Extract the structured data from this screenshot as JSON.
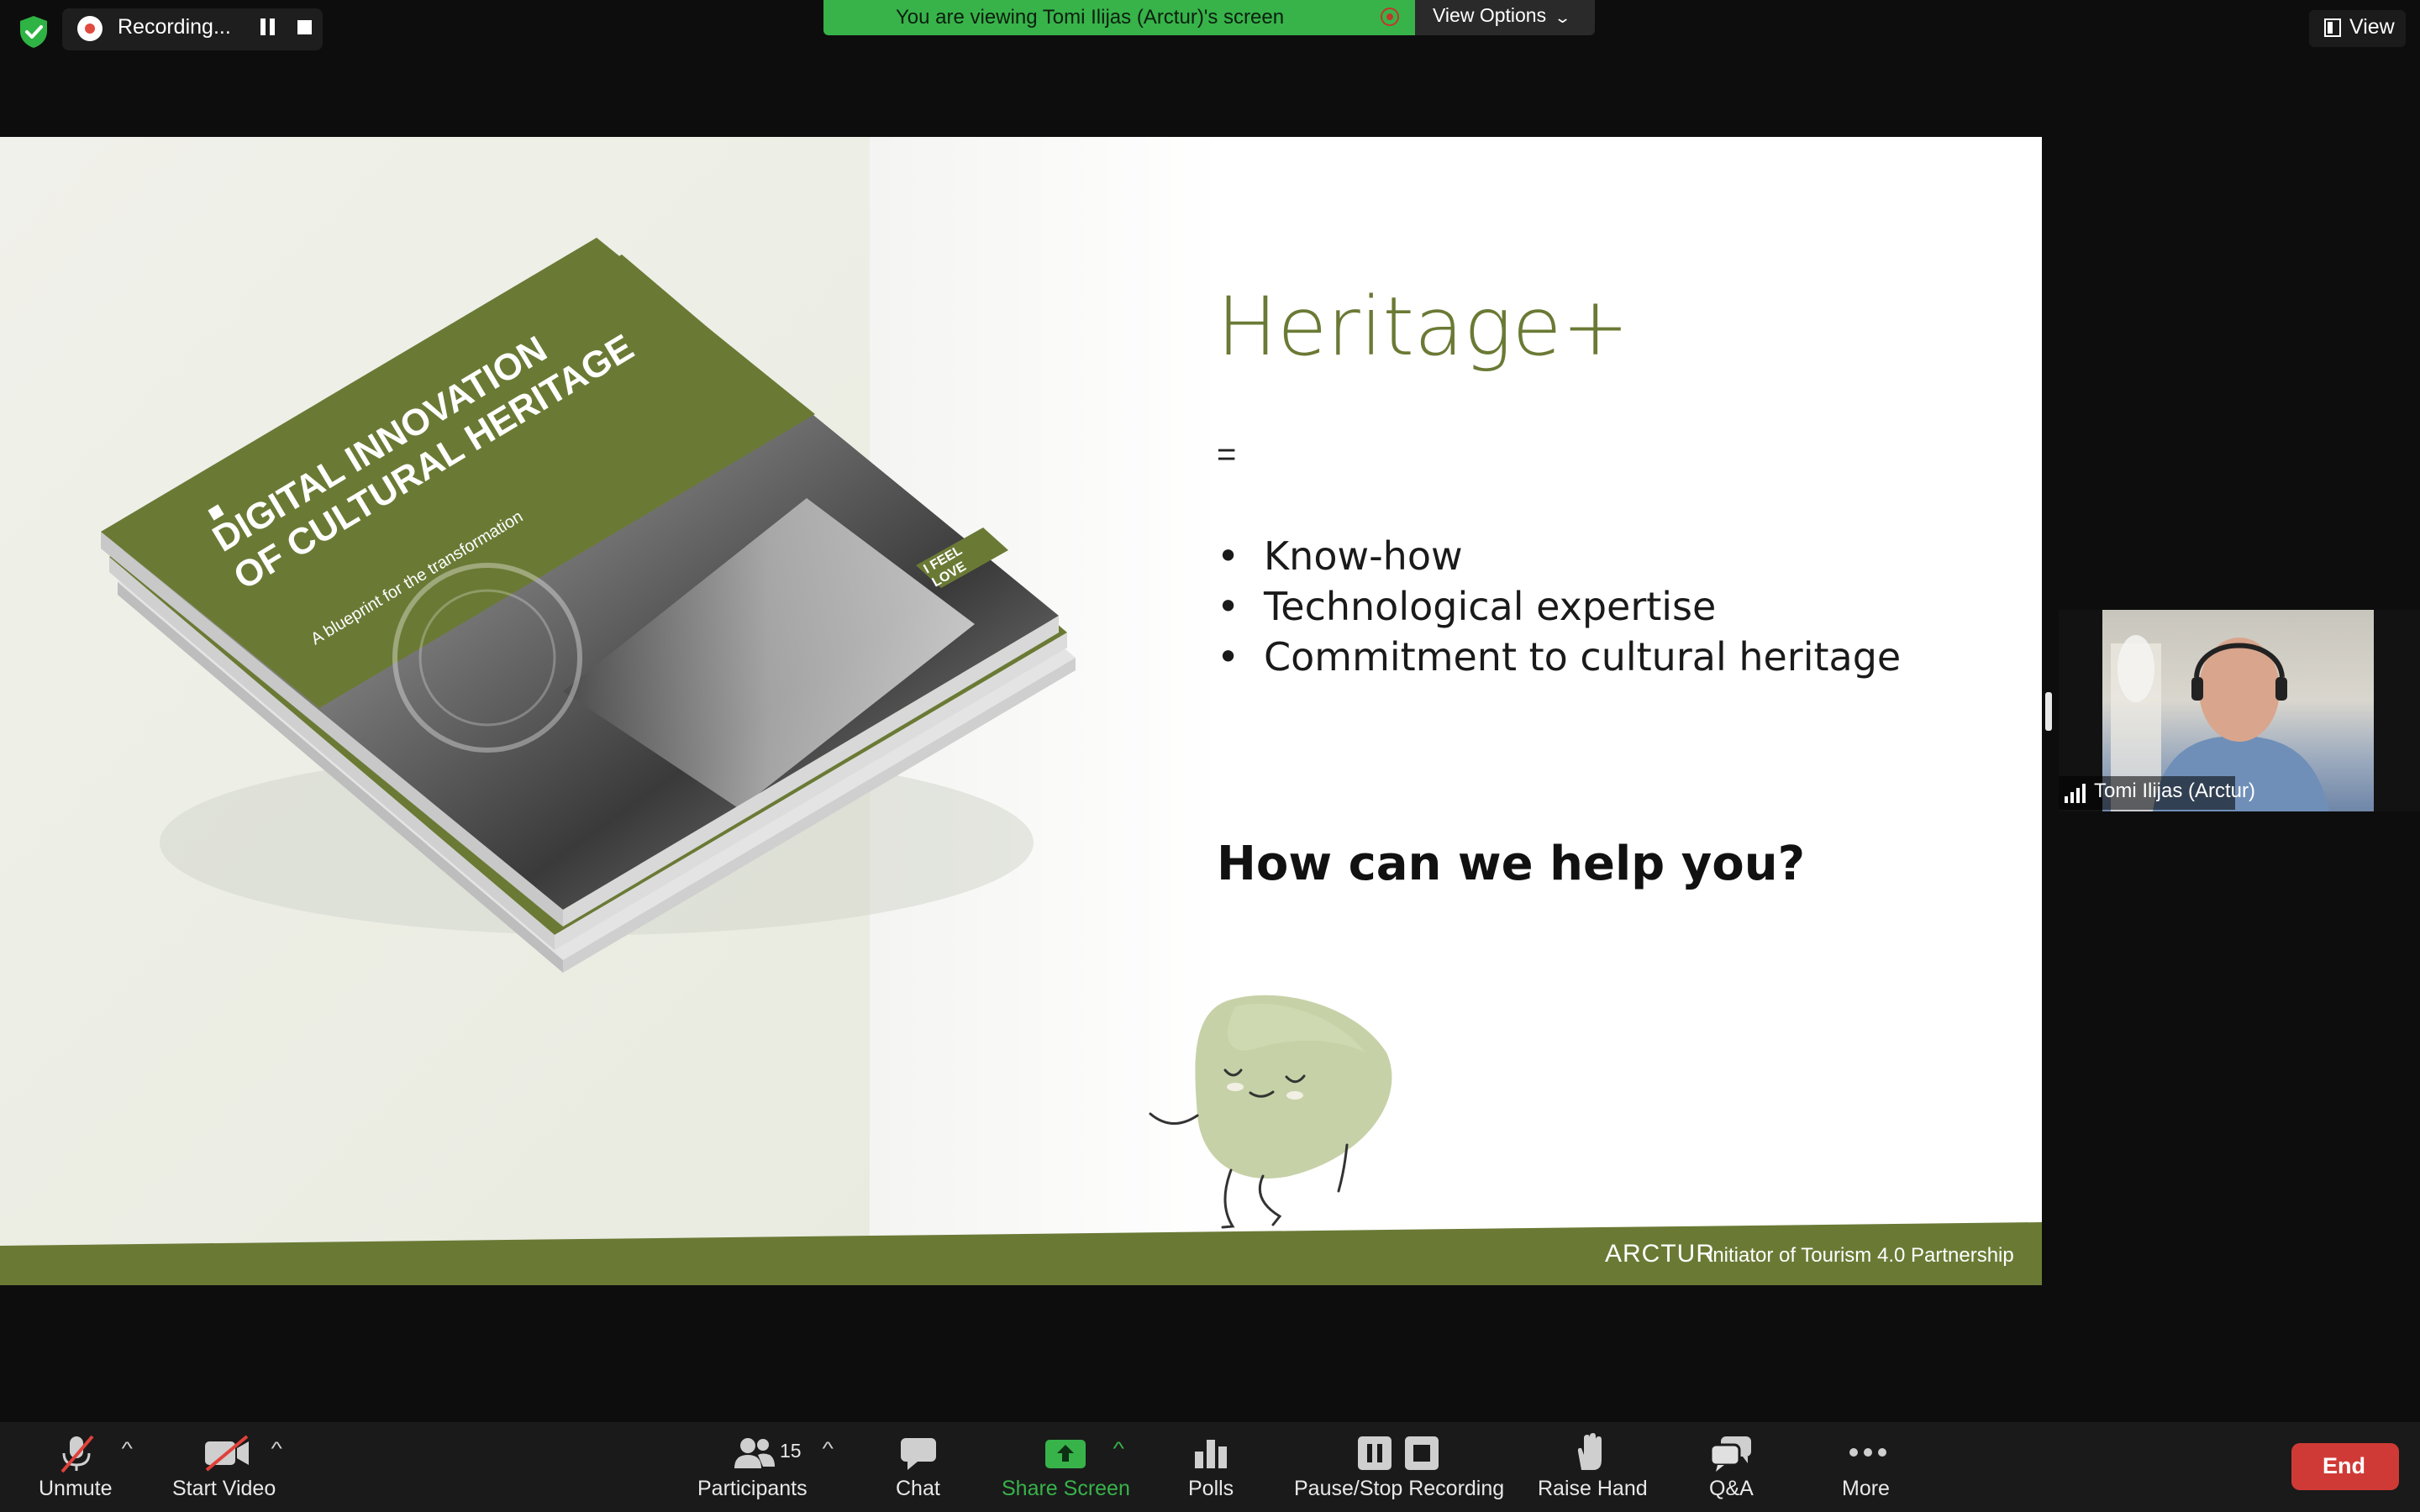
{
  "top_bar": {
    "recording_label": "Recording...",
    "viewing_banner": "You are viewing Tomi Ilijas (Arctur)'s screen",
    "view_options_label": "View Options",
    "view_label": "View"
  },
  "slide": {
    "title": "Heritage+",
    "equals": "=",
    "bullets": [
      "Know-how",
      "Technological expertise",
      "Commitment to cultural heritage"
    ],
    "question": "How can we help you?",
    "book_title_line1": "DIGITAL INNOVATION",
    "book_title_line2": "OF CULTURAL HERITAGE",
    "book_subtitle": "A blueprint for the transformation",
    "book_badge_line1": "I FEEL",
    "book_badge_line2": "LOVE",
    "footer_logo": "ARCTUR",
    "footer_text": "initiator of Tourism 4.0 Partnership",
    "accent_color": "#6a7a35"
  },
  "participant_video": {
    "name": "Tomi Ilijas (Arctur)"
  },
  "toolbar": {
    "unmute": "Unmute",
    "start_video": "Start Video",
    "participants": "Participants",
    "participants_count": "15",
    "chat": "Chat",
    "share_screen": "Share Screen",
    "polls": "Polls",
    "pause_stop_recording": "Pause/Stop Recording",
    "raise_hand": "Raise Hand",
    "qa": "Q&A",
    "more": "More",
    "end": "End"
  }
}
